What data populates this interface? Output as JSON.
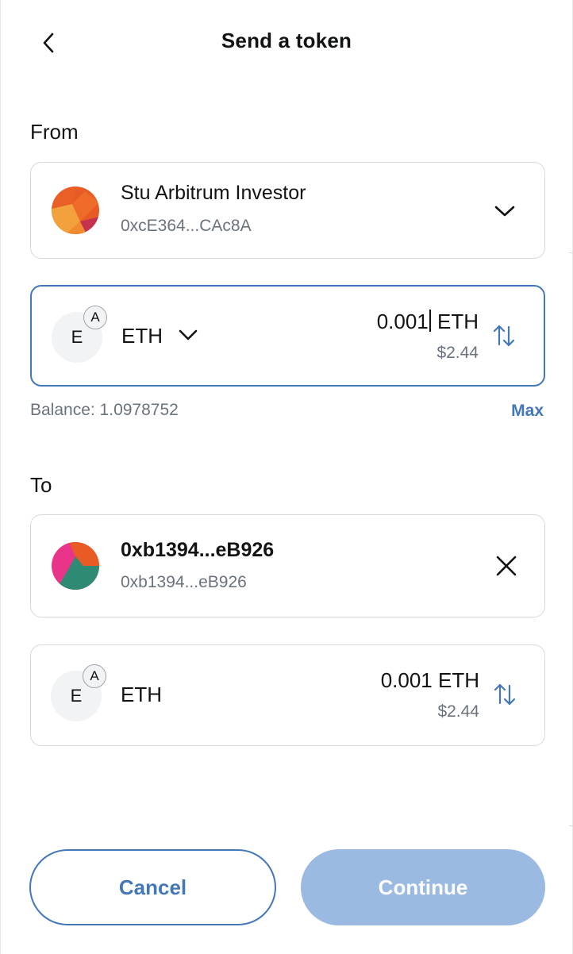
{
  "header": {
    "title": "Send a token"
  },
  "from": {
    "label": "From",
    "account_name": "Stu Arbitrum Investor",
    "account_address": "0xcE364...CAc8A",
    "token": {
      "icon_letter": "E",
      "network_badge": "A",
      "symbol": "ETH",
      "amount_before_caret": "0.001",
      "amount_after_caret": " ETH",
      "fiat": "$2.44"
    },
    "balance": "Balance: 1.0978752",
    "max_label": "Max"
  },
  "to": {
    "label": "To",
    "recipient_name": "0xb1394...eB926",
    "recipient_address": "0xb1394...eB926",
    "token": {
      "icon_letter": "E",
      "network_badge": "A",
      "symbol": "ETH",
      "amount": "0.001 ETH",
      "fiat": "$2.44"
    }
  },
  "actions": {
    "cancel_label": "Cancel",
    "continue_label": "Continue"
  },
  "colors": {
    "accent": "#4377b8",
    "muted": "#6a737d",
    "border": "#d6d9dc",
    "continue_disabled": "#9bbae2"
  }
}
